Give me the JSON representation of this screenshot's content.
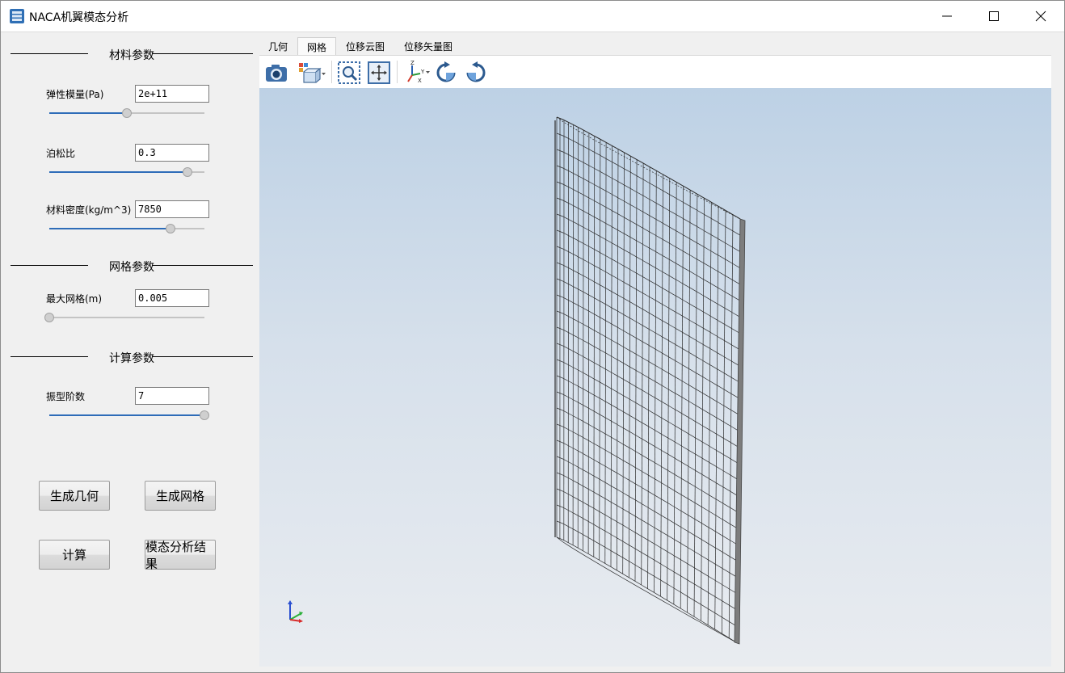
{
  "window": {
    "title": "NACA机翼模态分析",
    "controls": [
      "minimize-icon",
      "maximize-icon",
      "close-icon"
    ]
  },
  "left": {
    "sections": {
      "material": "材料参数",
      "mesh": "网格参数",
      "compute": "计算参数"
    },
    "params": {
      "modulus": {
        "label": "弹性模量(Pa)",
        "value": "2e+11",
        "slider_fraction": 0.5
      },
      "poisson": {
        "label": "泊松比",
        "value": "0.3",
        "slider_fraction": 0.89
      },
      "density": {
        "label": "材料密度(kg/m^3)",
        "value": "7850",
        "slider_fraction": 0.78
      },
      "max_mesh": {
        "label": "最大网格(m)",
        "value": "0.005",
        "slider_fraction": 0.0
      },
      "modes": {
        "label": "振型阶数",
        "value": "7",
        "slider_fraction": 1.0
      }
    },
    "buttons": {
      "gen_geometry": "生成几何",
      "gen_mesh": "生成网格",
      "compute": "计算",
      "modal_results": "模态分析结果"
    }
  },
  "tabs": [
    {
      "label": "几何",
      "active": false
    },
    {
      "label": "网格",
      "active": true
    },
    {
      "label": "位移云图",
      "active": false
    },
    {
      "label": "位移矢量图",
      "active": false
    }
  ],
  "toolbar": {
    "icons": [
      "camera-icon",
      "view-cube-icon",
      "zoom-box-icon",
      "fit-view-icon",
      "axes-orientation-icon",
      "rotate-cw-icon",
      "rotate-ccw-icon"
    ]
  },
  "colors": {
    "slider_fill": "#2e6cb8",
    "viewport_top": "#bdd1e5",
    "viewport_bottom": "#e9ecf0",
    "mesh_line": "#2a2a2a"
  }
}
